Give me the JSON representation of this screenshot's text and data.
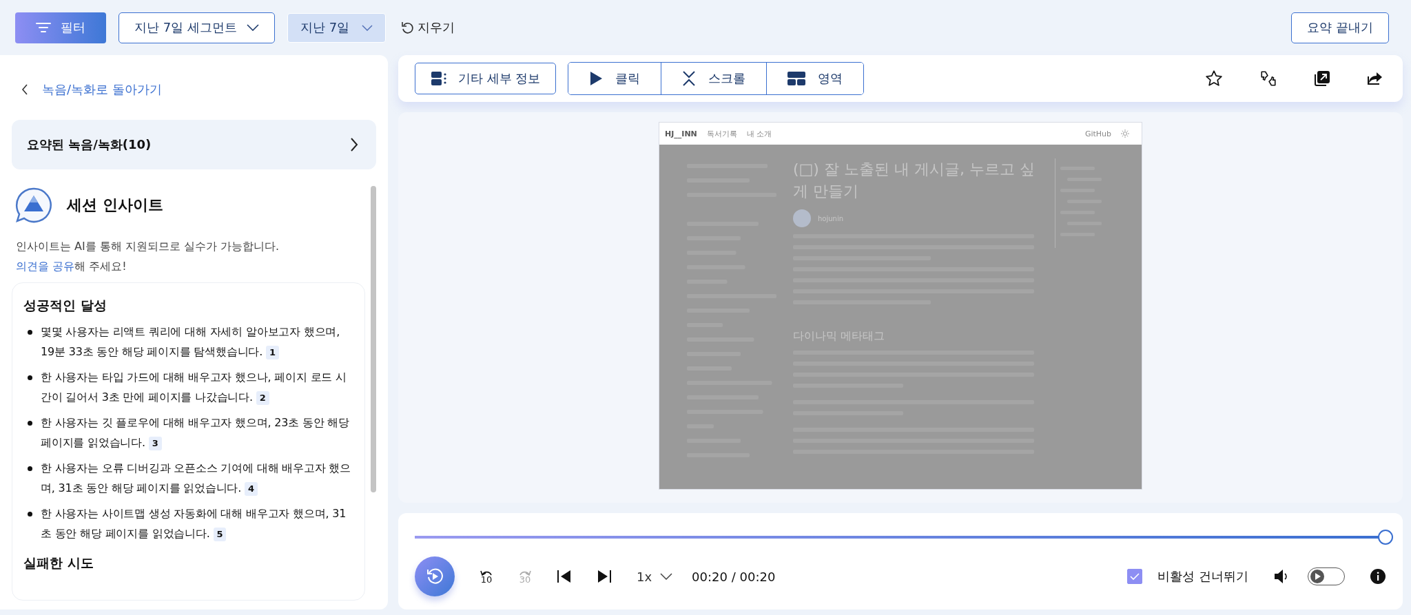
{
  "toolbar": {
    "filter_button": "필터",
    "segment_dropdown": "지난 7일 세그먼트",
    "date_dropdown": "지난 7일",
    "clear_button": "지우기",
    "end_summary_button": "요약 끝내기"
  },
  "sidebar": {
    "back_link": "녹음/녹화로 돌아가기",
    "summary_card": "요약된 녹음/녹화(10)",
    "insight": {
      "title": "세션 인사이트",
      "disclaimer": "인사이트는 AI를 통해 지원되므로 실수가 가능합니다.",
      "feedback_link": "의견을 공유",
      "feedback_suffix": "해 주세요!",
      "sections": [
        {
          "heading": "성공적인 달성",
          "items": [
            {
              "text": "몇몇 사용자는 리액트 쿼리에 대해 자세히 알아보고자 했으며, 19분 33초 동안 해당 페이지를 탐색했습니다.",
              "ref": "1"
            },
            {
              "text": "한 사용자는 타입 가드에 대해 배우고자 했으나, 페이지 로드 시간이 길어서 3초 만에 페이지를 나갔습니다.",
              "ref": "2"
            },
            {
              "text": "한 사용자는 깃 플로우에 대해 배우고자 했으며, 23초 동안 해당 페이지를 읽었습니다.",
              "ref": "3"
            },
            {
              "text": "한 사용자는 오류 디버깅과 오픈소스 기여에 대해 배우고자 했으며, 31초 동안 해당 페이지를 읽었습니다.",
              "ref": "4"
            },
            {
              "text": "한 사용자는 사이트맵 생성 자동화에 대해 배우고자 했으며, 31초 동안 해당 페이지를 읽었습니다.",
              "ref": "5"
            }
          ]
        },
        {
          "heading": "실패한 시도"
        }
      ]
    }
  },
  "viewer_tabs": {
    "details_button": "기타 세부 정보",
    "modes": [
      {
        "kind": "click",
        "label": "클릭"
      },
      {
        "kind": "scroll",
        "label": "스크롤"
      },
      {
        "kind": "area",
        "label": "영역"
      }
    ]
  },
  "replay": {
    "site_header": {
      "logo": "HJ__INN",
      "nav": [
        "독서기록",
        "내 소개"
      ],
      "github": "GitHub"
    },
    "post_title": "(□) 잘 노출된 내 게시글, 누르고 싶게 만들기",
    "author": "hojunin",
    "section_heading": "다이나믹 메타태그"
  },
  "player": {
    "progress": {
      "level": 1.0
    },
    "rewind": {
      "label": "10",
      "disabled": false
    },
    "forward": {
      "label": "30",
      "disabled": true
    },
    "speed": "1x",
    "time": "00:20 / 00:20",
    "skip_inactivity": {
      "label": "비활성 건너뛰기",
      "checked": true
    },
    "autoplay": {
      "on": false
    }
  }
}
